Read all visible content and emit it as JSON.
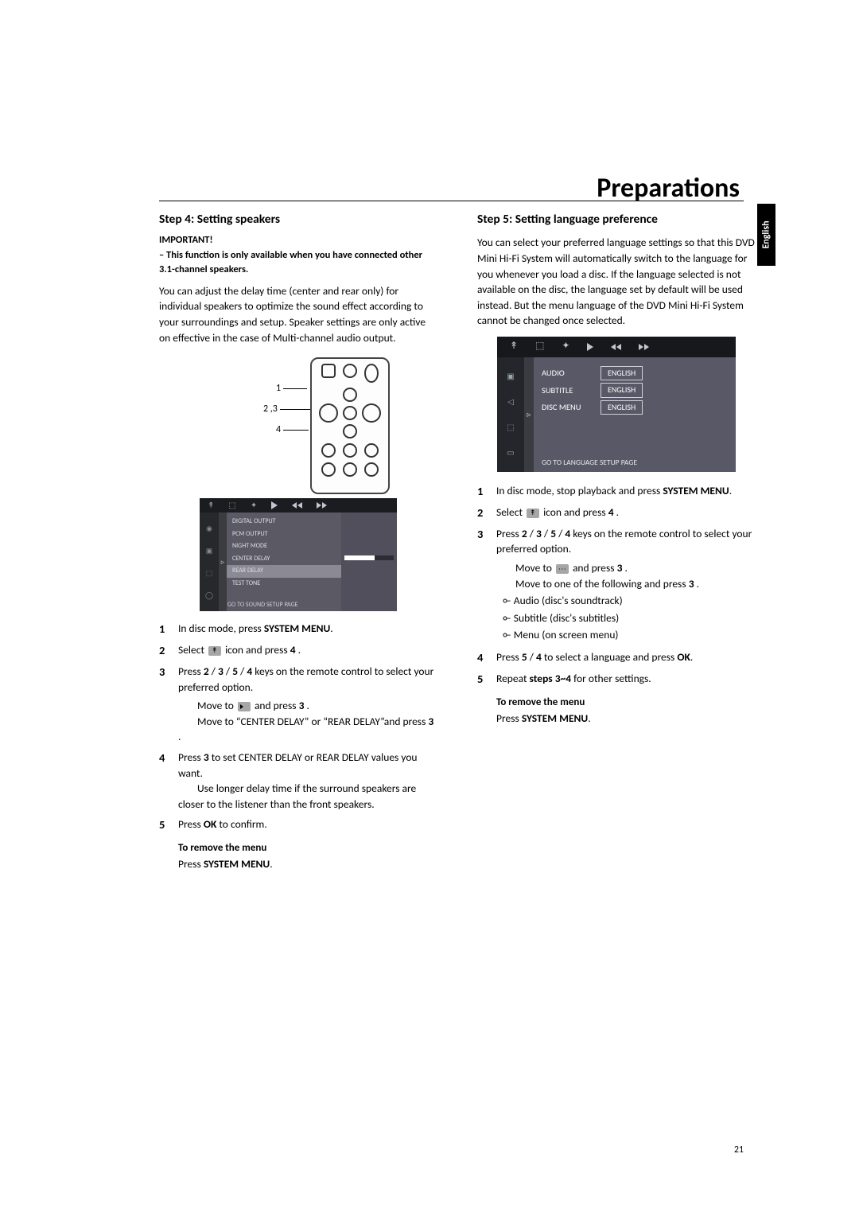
{
  "title": "Preparations",
  "language_tab": "English",
  "page_number": "21",
  "left": {
    "step_title": "Step 4:  Setting speakers",
    "important": "IMPORTANT!",
    "important_sub": "–  This function is only available when you have connected other 3.1-channel speakers.",
    "intro": "You can adjust the delay time (center and rear only) for individual speakers to optimize the sound effect according to your surroundings and setup. Speaker settings are only active on effective in the case of  Multi-channel audio output.",
    "callouts": {
      "c1": "1",
      "c2": "2 ,3",
      "c3": "4"
    },
    "menu_items": [
      "DIGITAL OUTPUT",
      "PCM OUTPUT",
      "NIGHT MODE",
      "CENTER DELAY",
      "REAR DELAY",
      "TEST TONE"
    ],
    "menu_selected": "REAR DELAY",
    "menu_footer": "GO TO SOUND SETUP PAGE",
    "steps": [
      {
        "n": "1",
        "pre": "In disc mode, press ",
        "bold": "SYSTEM MENU",
        "post": "."
      },
      {
        "n": "2",
        "pre": "Select ",
        "icon": "sound-level-icon",
        "mid": " icon and press ",
        "bold2": "4",
        "post2": " ."
      },
      {
        "n": "3",
        "pre": "Press ",
        "bold": "2",
        "mid1": "  / ",
        "bold2": "3",
        "mid2": "   / ",
        "bold3": "5",
        "mid3": "   / ",
        "bold4": "4",
        "post": "  keys on the remote control to select your preferred option.",
        "sub1_pre": "Move to ",
        "sub1_icon": "speaker-icon",
        "sub1_mid": " and press ",
        "sub1_bold": "3",
        "sub1_post": " .",
        "sub2_pre": "Move to “CENTER DELAY” or “REAR DELAY”and press ",
        "sub2_bold": "3",
        "sub2_post": " ."
      },
      {
        "n": "4",
        "pre": "Press ",
        "bold": "3",
        "post": "  to set CENTER DELAY or REAR DELAY values you want.",
        "note": "Use longer delay time if the surround speakers are closer to the listener than the front speakers."
      },
      {
        "n": "5",
        "pre": "Press ",
        "bold": "OK",
        "post": " to confirm."
      }
    ],
    "remove_h": "To remove the menu",
    "remove_pre": "Press ",
    "remove_bold": "SYSTEM MENU",
    "remove_post": "."
  },
  "right": {
    "step_title": "Step 5:  Setting language preference",
    "intro": "You can select your preferred language settings so that this DVD Mini Hi-Fi System will automatically switch to the language for you whenever you load a disc. If the language selected is not available on the disc, the language set by default will be used instead. But the menu language of the DVD Mini Hi-Fi System cannot be changed once selected.",
    "lang_rows": [
      {
        "label": "AUDIO",
        "value": "ENGLISH"
      },
      {
        "label": "SUBTITLE",
        "value": "ENGLISH"
      },
      {
        "label": "DISC MENU",
        "value": "ENGLISH"
      }
    ],
    "lang_footer": "GO TO LANGUAGE SETUP PAGE",
    "steps": [
      {
        "n": "1",
        "pre": "In disc mode, stop playback and press ",
        "bold": "SYSTEM MENU",
        "post": "."
      },
      {
        "n": "2",
        "pre": "Select ",
        "icon": "sound-level-icon",
        "mid": " icon and press ",
        "bold2": "4",
        "post2": " ."
      },
      {
        "n": "3",
        "pre": "Press ",
        "bold": "2",
        "mid1": "  / ",
        "bold2": "3",
        "mid2": "   / ",
        "bold3": "5",
        "mid3": "   / ",
        "bold4": "4",
        "post": "  keys on the remote control to select your preferred option.",
        "sub1_pre": "Move to ",
        "sub1_icon": "subtitle-icon",
        "sub1_mid": " and press ",
        "sub1_bold": "3",
        "sub1_post": " .",
        "sub2_pre": "Move to one of the following and press ",
        "sub2_bold": "3",
        "sub2_post": " .",
        "bullets": [
          "Audio (disc's soundtrack)",
          "Subtitle (disc's subtitles)",
          "Menu (on screen menu)"
        ]
      },
      {
        "n": "4",
        "pre": "Press ",
        "bold": "5",
        "mid1": "  /  ",
        "bold2": "4",
        "post": " to select a language and press ",
        "bold3": "OK",
        "post2": "."
      },
      {
        "n": "5",
        "pre": "Repeat ",
        "bold": "steps 3~4",
        "post": " for other settings."
      }
    ],
    "remove_h": "To remove the menu",
    "remove_pre": "Press ",
    "remove_bold": "SYSTEM MENU",
    "remove_post": "."
  }
}
